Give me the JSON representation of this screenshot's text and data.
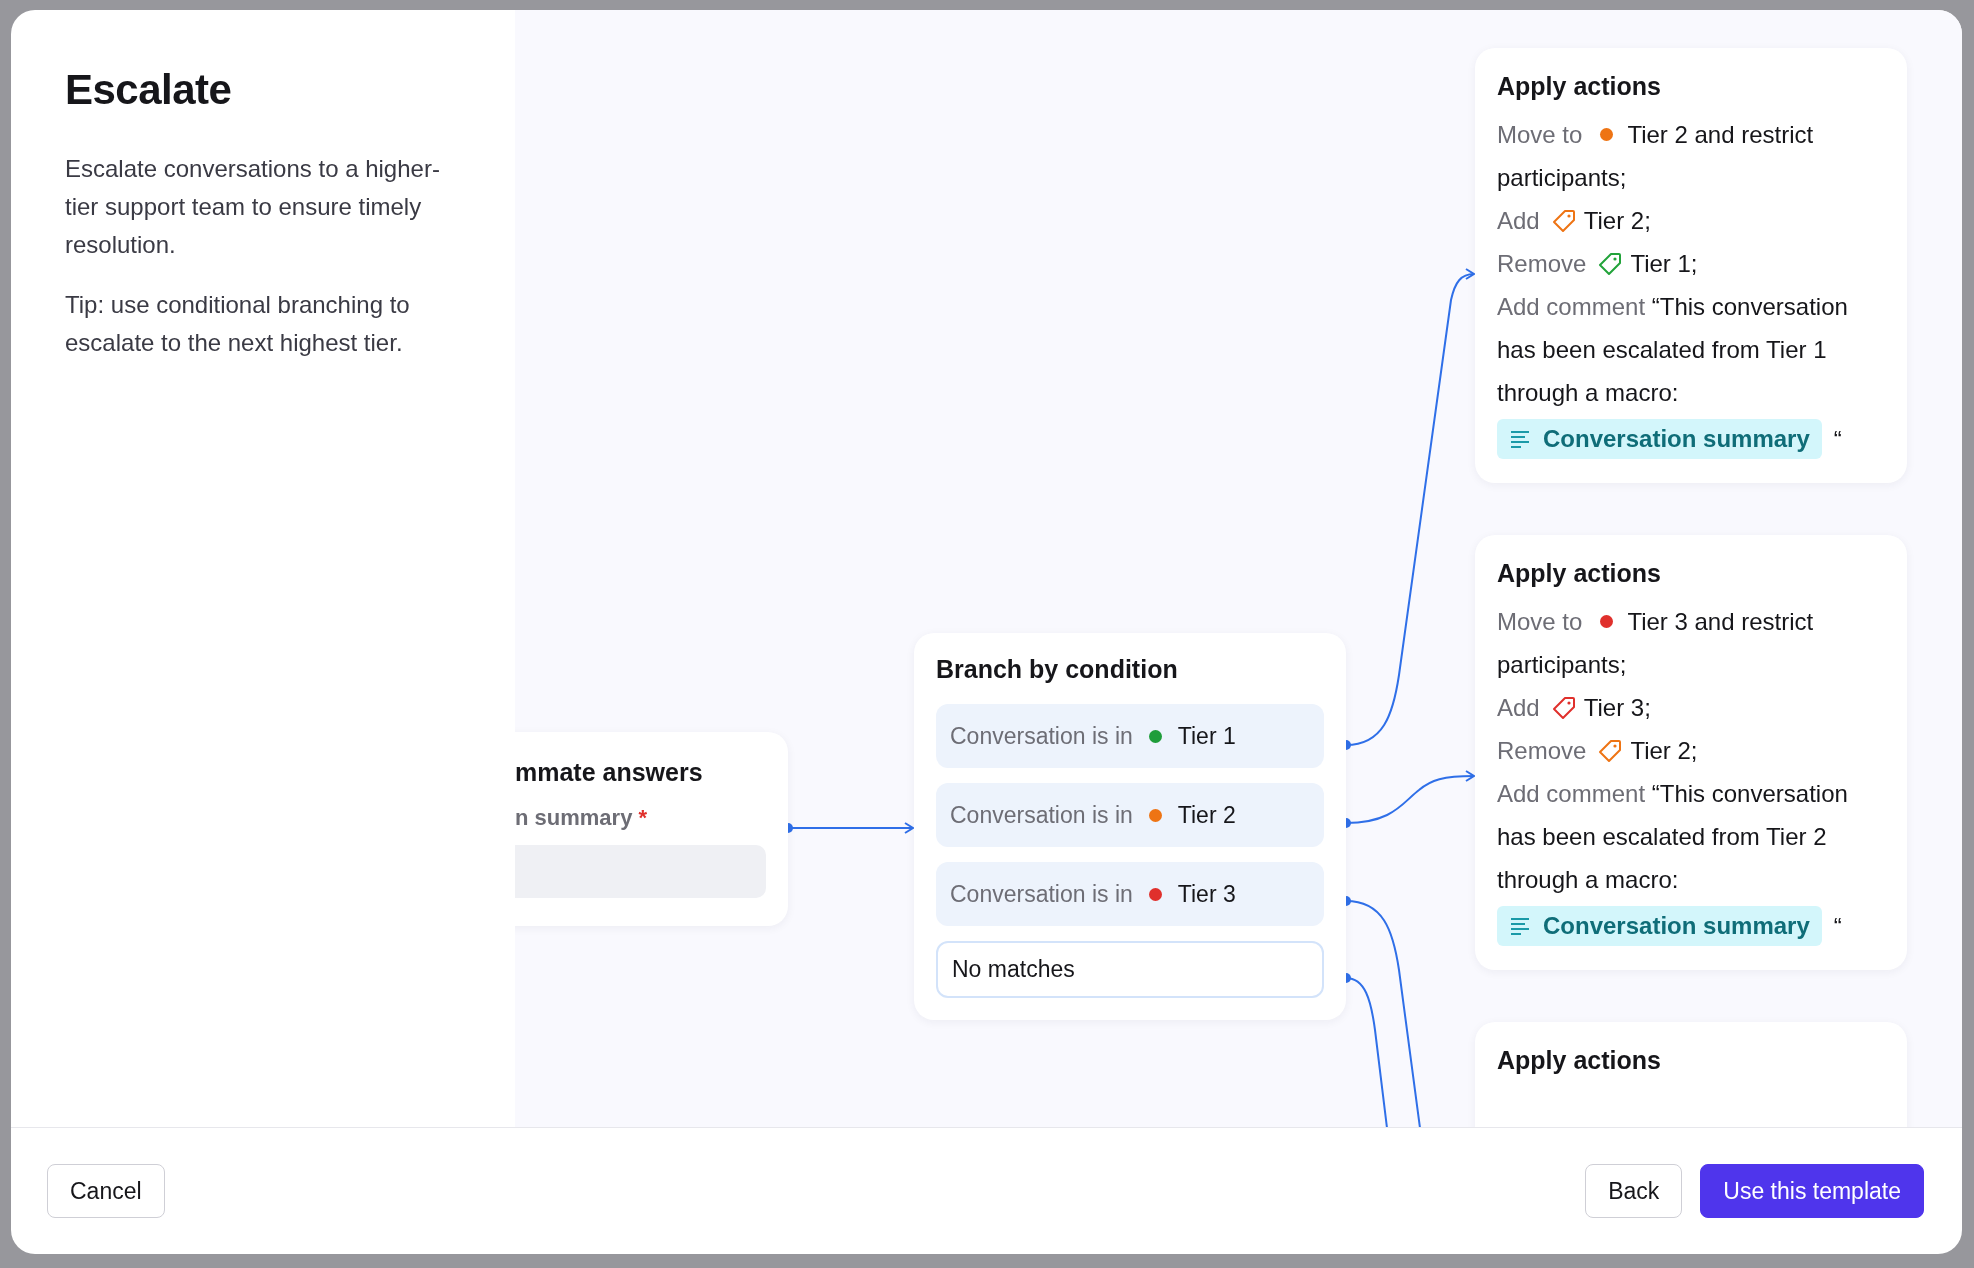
{
  "intro": {
    "title": "Escalate",
    "paragraphs": [
      "Escalate conversations to a higher-tier support team to ensure timely resolution.",
      "Tip: use conditional branching to escalate to the next highest tier."
    ]
  },
  "partial_node": {
    "title": "mmate answers",
    "field_label": "n summary",
    "required_mark": "*"
  },
  "branch_node": {
    "title": "Branch by condition",
    "rows": [
      {
        "kind": "condition",
        "label": "Conversation is in",
        "color": "#1f9d3a",
        "value": "Tier 1"
      },
      {
        "kind": "condition",
        "label": "Conversation is in",
        "color": "#ee7414",
        "value": "Tier 2"
      },
      {
        "kind": "condition",
        "label": "Conversation is in",
        "color": "#e0302c",
        "value": "Tier 3"
      },
      {
        "kind": "fallback",
        "value": "No matches"
      }
    ]
  },
  "action_cards": [
    {
      "title": "Apply actions",
      "actions": [
        {
          "kind": "move",
          "label": "Move to",
          "color": "#ee7414",
          "text": "Tier 2 and restrict participants;"
        },
        {
          "kind": "tag",
          "label": "Add",
          "color": "#ee7414",
          "text": "Tier 2;"
        },
        {
          "kind": "tag",
          "label": "Remove",
          "color": "#22a33a",
          "text": "Tier 1;"
        },
        {
          "kind": "comment",
          "label": "Add comment",
          "text": "“This conversation has been escalated from Tier 1 through a macro:",
          "chip": "Conversation summary",
          "closing": "“"
        }
      ]
    },
    {
      "title": "Apply actions",
      "actions": [
        {
          "kind": "move",
          "label": "Move to",
          "color": "#e0302c",
          "text": "Tier 3 and restrict participants;"
        },
        {
          "kind": "tag",
          "label": "Add",
          "color": "#e0302c",
          "text": "Tier 3;"
        },
        {
          "kind": "tag",
          "label": "Remove",
          "color": "#ee7414",
          "text": "Tier 2;"
        },
        {
          "kind": "comment",
          "label": "Add comment",
          "text": "“This conversation has been escalated from Tier 2 through a macro:",
          "chip": "Conversation summary",
          "closing": "“"
        }
      ]
    },
    {
      "title": "Apply actions"
    }
  ],
  "footer": {
    "left_buttons": [
      {
        "label": "Cancel",
        "kind": "secondary"
      }
    ],
    "right_buttons": [
      {
        "label": "Back",
        "kind": "secondary"
      },
      {
        "label": "Use this template",
        "kind": "primary"
      }
    ]
  }
}
